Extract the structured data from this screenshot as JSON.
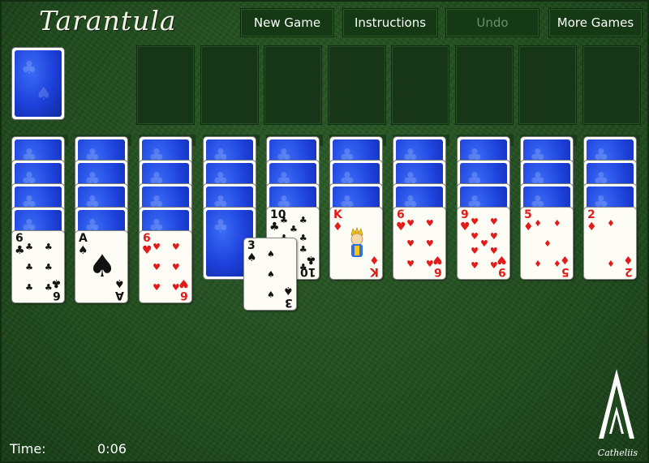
{
  "game": {
    "title": "Tarantula"
  },
  "toolbar": {
    "new_game": "New Game",
    "instructions": "Instructions",
    "undo": "Undo",
    "more_games": "More Games"
  },
  "footer": {
    "time_label": "Time:",
    "time_value": "0:06"
  },
  "brand": {
    "name": "Catheliis",
    "logo_icon": "stylized-a-chevron-logo"
  },
  "colors": {
    "felt": "#1f4a1d",
    "card_back": "#1c3fd9",
    "red_suit": "#e21b1b"
  },
  "stock": {
    "icon": "card-back"
  },
  "foundation_slots": 8,
  "tableau": [
    {
      "hidden": 4,
      "faces": [
        {
          "rank": "6",
          "suit": "♣",
          "color": "black"
        }
      ]
    },
    {
      "hidden": 4,
      "faces": [
        {
          "rank": "A",
          "suit": "♠",
          "color": "black"
        }
      ]
    },
    {
      "hidden": 4,
      "faces": [
        {
          "rank": "6",
          "suit": "♥",
          "color": "red"
        }
      ]
    },
    {
      "hidden": 4,
      "faces": []
    },
    {
      "hidden": 3,
      "faces": [
        {
          "rank": "10",
          "suit": "♣",
          "color": "black"
        }
      ]
    },
    {
      "hidden": 3,
      "faces": [
        {
          "rank": "K",
          "suit": "♦",
          "color": "red"
        }
      ]
    },
    {
      "hidden": 3,
      "faces": [
        {
          "rank": "6",
          "suit": "♥",
          "color": "red"
        }
      ]
    },
    {
      "hidden": 3,
      "faces": [
        {
          "rank": "9",
          "suit": "♥",
          "color": "red"
        }
      ]
    },
    {
      "hidden": 3,
      "faces": [
        {
          "rank": "5",
          "suit": "♦",
          "color": "red"
        }
      ]
    },
    {
      "hidden": 3,
      "faces": [
        {
          "rank": "2",
          "suit": "♦",
          "color": "red"
        }
      ]
    }
  ],
  "dragging_card": {
    "rank": "3",
    "suit": "♠",
    "color": "black"
  }
}
